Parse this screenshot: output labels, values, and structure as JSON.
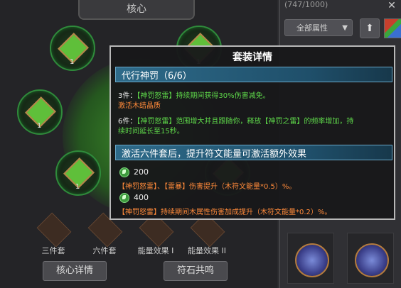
{
  "core_panel": {
    "title": "核心",
    "socket_numbers": [
      "1",
      "1",
      "1",
      "1",
      "1"
    ],
    "bottom_labels": [
      "三件套",
      "六件套",
      "能量效果 I",
      "能量效果 II"
    ],
    "core_detail_button": "核心详情",
    "rune_resonance_button": "符石共鸣"
  },
  "right_panel": {
    "count_text": "(747/1000)",
    "attribute_filter": "全部属性",
    "sort_icon": "up-arrow-icon",
    "close_icon": "close-icon"
  },
  "tooltip": {
    "title": "套装详情",
    "set_header": "代行神罚（6/6）",
    "piece3_prefix": "3件：",
    "piece3_skill": "【神罚怒雷】",
    "piece3_text": "持续期间获得30%伤害减免。",
    "piece3_note": "激活木结晶质",
    "piece6_prefix": "6件：",
    "piece6_skill": "【神罚怒雷】",
    "piece6_text_a": "范围增大并且跟随你，释放",
    "piece6_skill2": "【神罚之雷】",
    "piece6_text_b": "的频率增加，持",
    "piece6_text_c": "续时间延长至15秒。",
    "extra_header": "激活六件套后，提升符文能量可激活额外效果",
    "effect1_threshold": "200",
    "effect1_text": "【神罚怒雷】、【雷暴】伤害提升（木符文能量*0.5）%。",
    "effect2_threshold": "400",
    "effect2_text": "【神罚怒雷】持续期间木属性伤害加成提升（木符文能量*0.2）%。"
  },
  "colors": {
    "accent_blue": "#2e6b8a",
    "orange_text": "#ff8a3a",
    "green_text": "#5ed84a",
    "socket_green": "#2f8b3b"
  }
}
